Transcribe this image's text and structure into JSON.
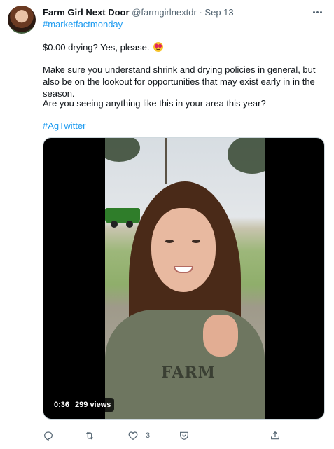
{
  "tweet": {
    "display_name": "Farm Girl Next Door",
    "handle": "@farmgirlnextdr",
    "separator": "·",
    "date": "Sep 13",
    "hashtag_top": "#marketfactmonday",
    "line1": "$0.00 drying? Yes, please.",
    "line1_emoji": "smiling-face-with-heart-eyes",
    "line2": "Make sure you understand shrink and drying policies in general, but also be on the lookout for opportunities that may exist early in in the season.",
    "line3": "Are you seeing anything like this in your area this year?",
    "hashtag_bottom": "#AgTwitter"
  },
  "video": {
    "duration": "0:36",
    "views": "299 views",
    "shirt_text": "FARM"
  },
  "actions": {
    "reply_icon": "reply-icon",
    "retweet_icon": "retweet-icon",
    "like_icon": "heart-icon",
    "like_count": "3",
    "save_icon": "shield-icon",
    "share_icon": "share-icon"
  },
  "colors": {
    "accent": "#1d9bf0",
    "secondary_text": "#536471"
  }
}
